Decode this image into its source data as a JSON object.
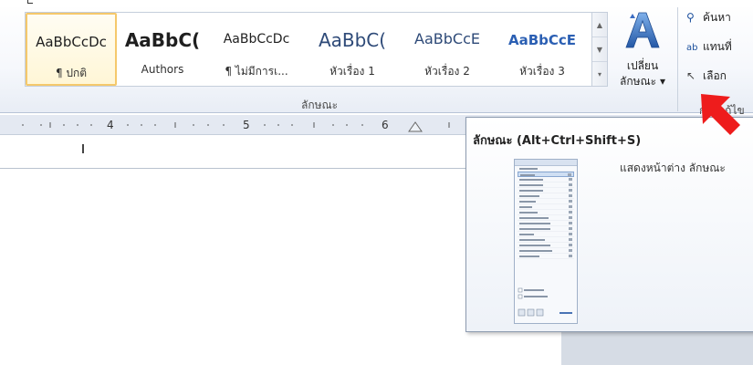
{
  "ribbon": {
    "styles_gallery": {
      "items": [
        {
          "sample": "AaBbCcDc",
          "name": "¶ ปกติ",
          "selected": true
        },
        {
          "sample": "AaBbC(",
          "name": "Authors"
        },
        {
          "sample": "AaBbCcDc",
          "name": "¶ ไม่มีการเ..."
        },
        {
          "sample": "AaBbC(",
          "name": "หัวเรื่อง 1"
        },
        {
          "sample": "AaBbCcE",
          "name": "หัวเรื่อง 2"
        },
        {
          "sample": "AaBbCcE",
          "name": "หัวเรื่อง 3"
        }
      ],
      "group_label": "ลักษณะ"
    },
    "change_styles": {
      "line1": "เปลี่ยน",
      "line2": "ลักษณะ ▾"
    },
    "editing": {
      "find": "ค้นหา",
      "replace": "แทนที่",
      "select": "เลือก",
      "group_label": "การแก้ไข"
    }
  },
  "ruler": {
    "numbers": [
      "4",
      "5",
      "6"
    ]
  },
  "tooltip": {
    "title": "ลักษณะ (Alt+Ctrl+Shift+S)",
    "description": "แสดงหน้าต่าง ลักษณะ"
  },
  "colors": {
    "accent_arrow": "#ee1c1c",
    "selected_style_border": "#f5c86b",
    "blue_text": "#2b5fb3"
  }
}
